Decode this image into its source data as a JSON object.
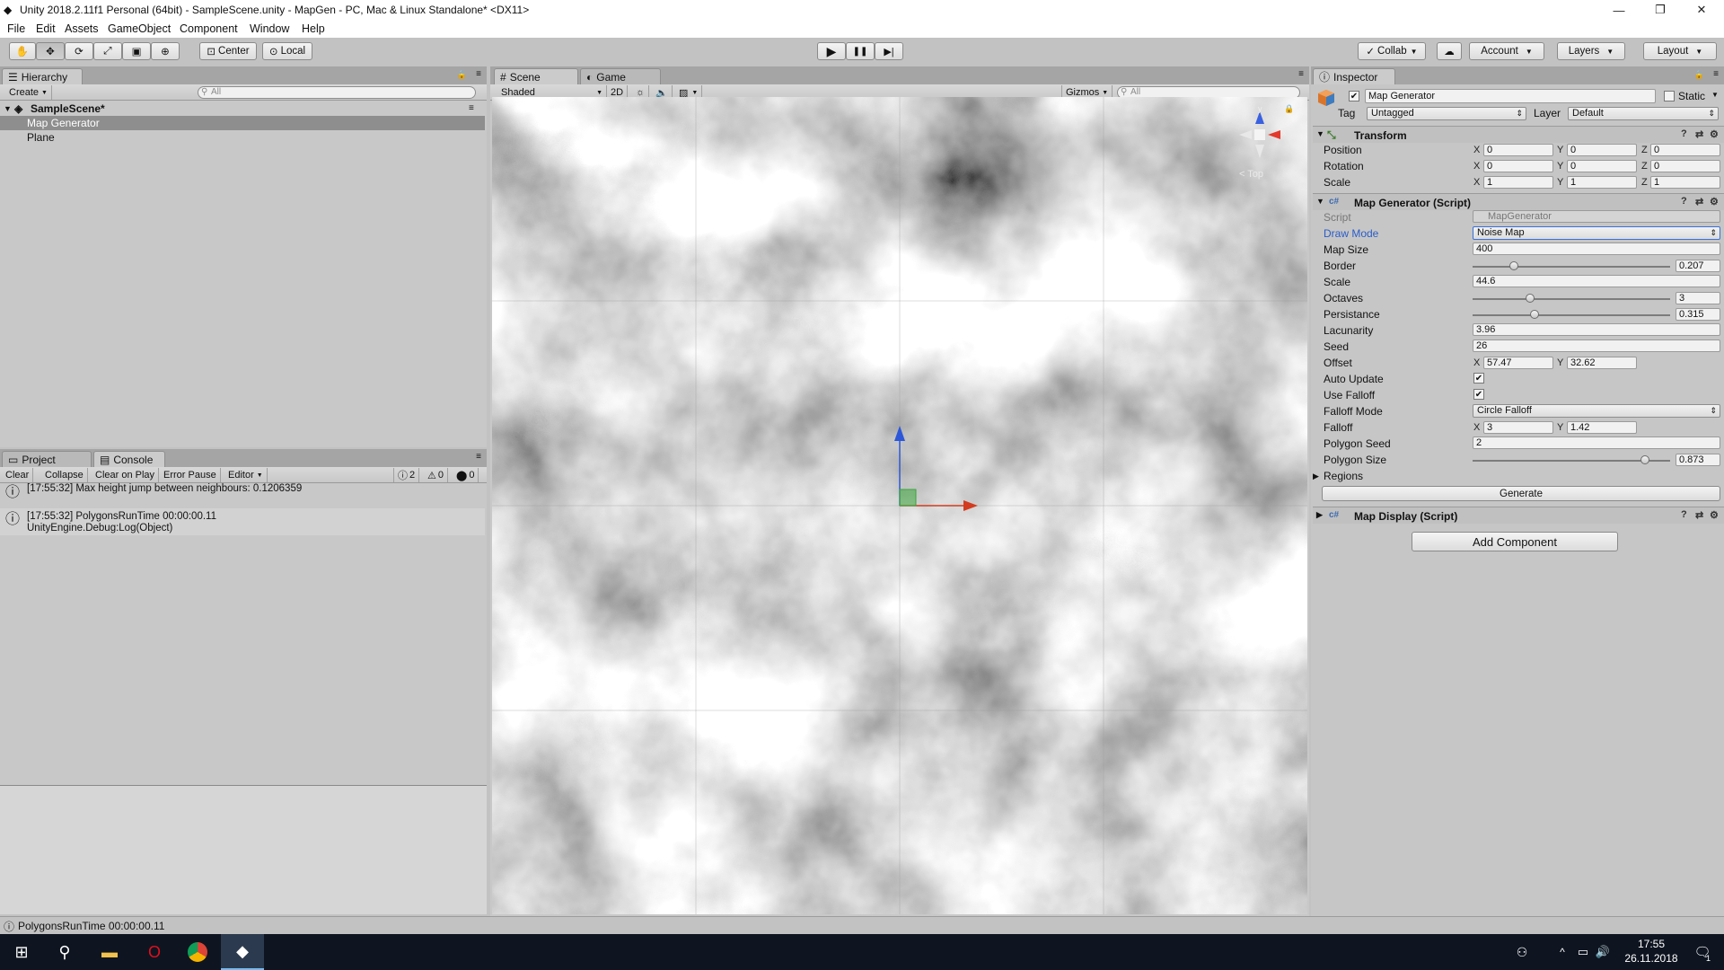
{
  "window": {
    "title": "Unity 2018.2.11f1 Personal (64bit) - SampleScene.unity - MapGen - PC, Mac & Linux Standalone* <DX11>",
    "minimize": "—",
    "maximize": "❐",
    "close": "✕"
  },
  "menu": [
    "File",
    "Edit",
    "Assets",
    "GameObject",
    "Component",
    "Window",
    "Help"
  ],
  "toolbar": {
    "tools": [
      "hand-tool",
      "move-tool",
      "rotate-tool",
      "scale-tool",
      "rect-tool",
      "transform-tool"
    ],
    "pivot_mode": "Center",
    "pivot_rotation": "Local",
    "play": "▶",
    "pause": "❚❚",
    "step": "▶|",
    "collab": "Collab",
    "account": "Account",
    "layers": "Layers",
    "layout": "Layout"
  },
  "hierarchy": {
    "tab": "Hierarchy",
    "create": "Create",
    "search_placeholder": "All",
    "scene": "SampleScene*",
    "items": [
      "Map Generator",
      "Plane"
    ],
    "selected": "Map Generator"
  },
  "bottom_tabs": {
    "project": "Project",
    "console": "Console"
  },
  "console": {
    "buttons": [
      "Clear",
      "Collapse",
      "Clear on Play",
      "Error Pause",
      "Editor"
    ],
    "counts": {
      "info": "2",
      "warn": "0",
      "error": "0"
    },
    "entries": [
      {
        "line1": "[17:55:32] Max height jump between neighbours: 0.1206359",
        "line2": ""
      },
      {
        "line1": "[17:55:32] PolygonsRunTime 00:00:00.11",
        "line2": "UnityEngine.Debug:Log(Object)"
      }
    ]
  },
  "scene": {
    "tab_scene": "Scene",
    "tab_game": "Game",
    "shading": "Shaded",
    "mode_2d": "2D",
    "gizmos": "Gizmos",
    "search_placeholder": "All",
    "gizmo_view": "< Top",
    "axis_y": "y",
    "axis_x": "x"
  },
  "inspector": {
    "tab": "Inspector",
    "object_name": "Map Generator",
    "static_label": "Static",
    "tag_label": "Tag",
    "tag_value": "Untagged",
    "layer_label": "Layer",
    "layer_value": "Default",
    "transform": {
      "title": "Transform",
      "position": {
        "label": "Position",
        "x": "0",
        "y": "0",
        "z": "0"
      },
      "rotation": {
        "label": "Rotation",
        "x": "0",
        "y": "0",
        "z": "0"
      },
      "scale": {
        "label": "Scale",
        "x": "1",
        "y": "1",
        "z": "1"
      }
    },
    "map_generator": {
      "title": "Map Generator (Script)",
      "script_label": "Script",
      "script_value": "MapGenerator",
      "draw_mode_label": "Draw Mode",
      "draw_mode_value": "Noise Map",
      "map_size_label": "Map Size",
      "map_size_value": "400",
      "border_label": "Border",
      "border_value": "0.207",
      "border_fraction": 0.207,
      "scale_label": "Scale",
      "scale_value": "44.6",
      "octaves_label": "Octaves",
      "octaves_value": "3",
      "octaves_fraction": 0.29,
      "persistance_label": "Persistance",
      "persistance_value": "0.315",
      "persistance_fraction": 0.315,
      "lacunarity_label": "Lacunarity",
      "lacunarity_value": "3.96",
      "seed_label": "Seed",
      "seed_value": "26",
      "offset_label": "Offset",
      "offset_x": "57.47",
      "offset_y": "32.62",
      "auto_update_label": "Auto Update",
      "use_falloff_label": "Use Falloff",
      "falloff_mode_label": "Falloff Mode",
      "falloff_mode_value": "Circle Falloff",
      "falloff_label": "Falloff",
      "falloff_x": "3",
      "falloff_y": "1.42",
      "polygon_seed_label": "Polygon Seed",
      "polygon_seed_value": "2",
      "polygon_size_label": "Polygon Size",
      "polygon_size_value": "0.873",
      "polygon_size_fraction": 0.873,
      "regions_label": "Regions",
      "generate": "Generate"
    },
    "map_display": {
      "title": "Map Display (Script)"
    },
    "add_component": "Add Component"
  },
  "status_bar": "PolygonsRunTime 00:00:00.11",
  "taskbar": {
    "time": "17:55",
    "date": "26.11.2018",
    "notif": "1"
  },
  "colors": {
    "accent_label": "#2a5cc9",
    "selection": "#8e8e8e",
    "panel": "#c8c8c8"
  }
}
